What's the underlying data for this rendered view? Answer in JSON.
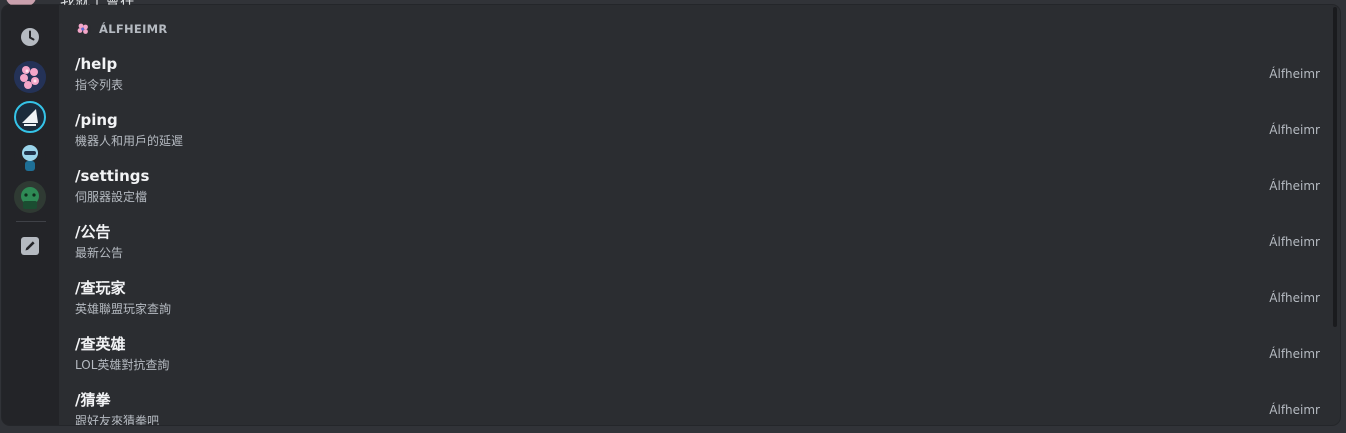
{
  "behind": {
    "message_text": "我就上會在"
  },
  "rail": {
    "items": [
      {
        "name": "recent",
        "icon": "clock-icon"
      },
      {
        "name": "alfheimr",
        "icon": "sakura-server-icon"
      },
      {
        "name": "bot-2",
        "icon": "sail-bot-icon"
      },
      {
        "name": "bot-3",
        "icon": "robot-avatar-icon"
      },
      {
        "name": "bot-4",
        "icon": "green-bot-icon"
      },
      {
        "name": "builtin",
        "icon": "pencil-icon"
      }
    ]
  },
  "section": {
    "title": "ÁLFHEIMR",
    "icon": "sakura-server-icon"
  },
  "commands": [
    {
      "name": "/help",
      "description": "指令列表",
      "source": "Álfheimr"
    },
    {
      "name": "/ping",
      "description": "機器人和用戶的延遲",
      "source": "Álfheimr"
    },
    {
      "name": "/settings",
      "description": "伺服器設定檔",
      "source": "Álfheimr"
    },
    {
      "name": "/公告",
      "description": "最新公告",
      "source": "Álfheimr"
    },
    {
      "name": "/查玩家",
      "description": "英雄聯盟玩家查詢",
      "source": "Álfheimr"
    },
    {
      "name": "/查英雄",
      "description": "LOL英雄對抗查詢",
      "source": "Álfheimr"
    },
    {
      "name": "/猜拳",
      "description": "跟好友來猜拳吧",
      "source": "Álfheimr"
    }
  ],
  "colors": {
    "background": "#2b2d31",
    "rail": "#232428",
    "text": "#f2f3f5",
    "muted": "#b5bac1"
  }
}
